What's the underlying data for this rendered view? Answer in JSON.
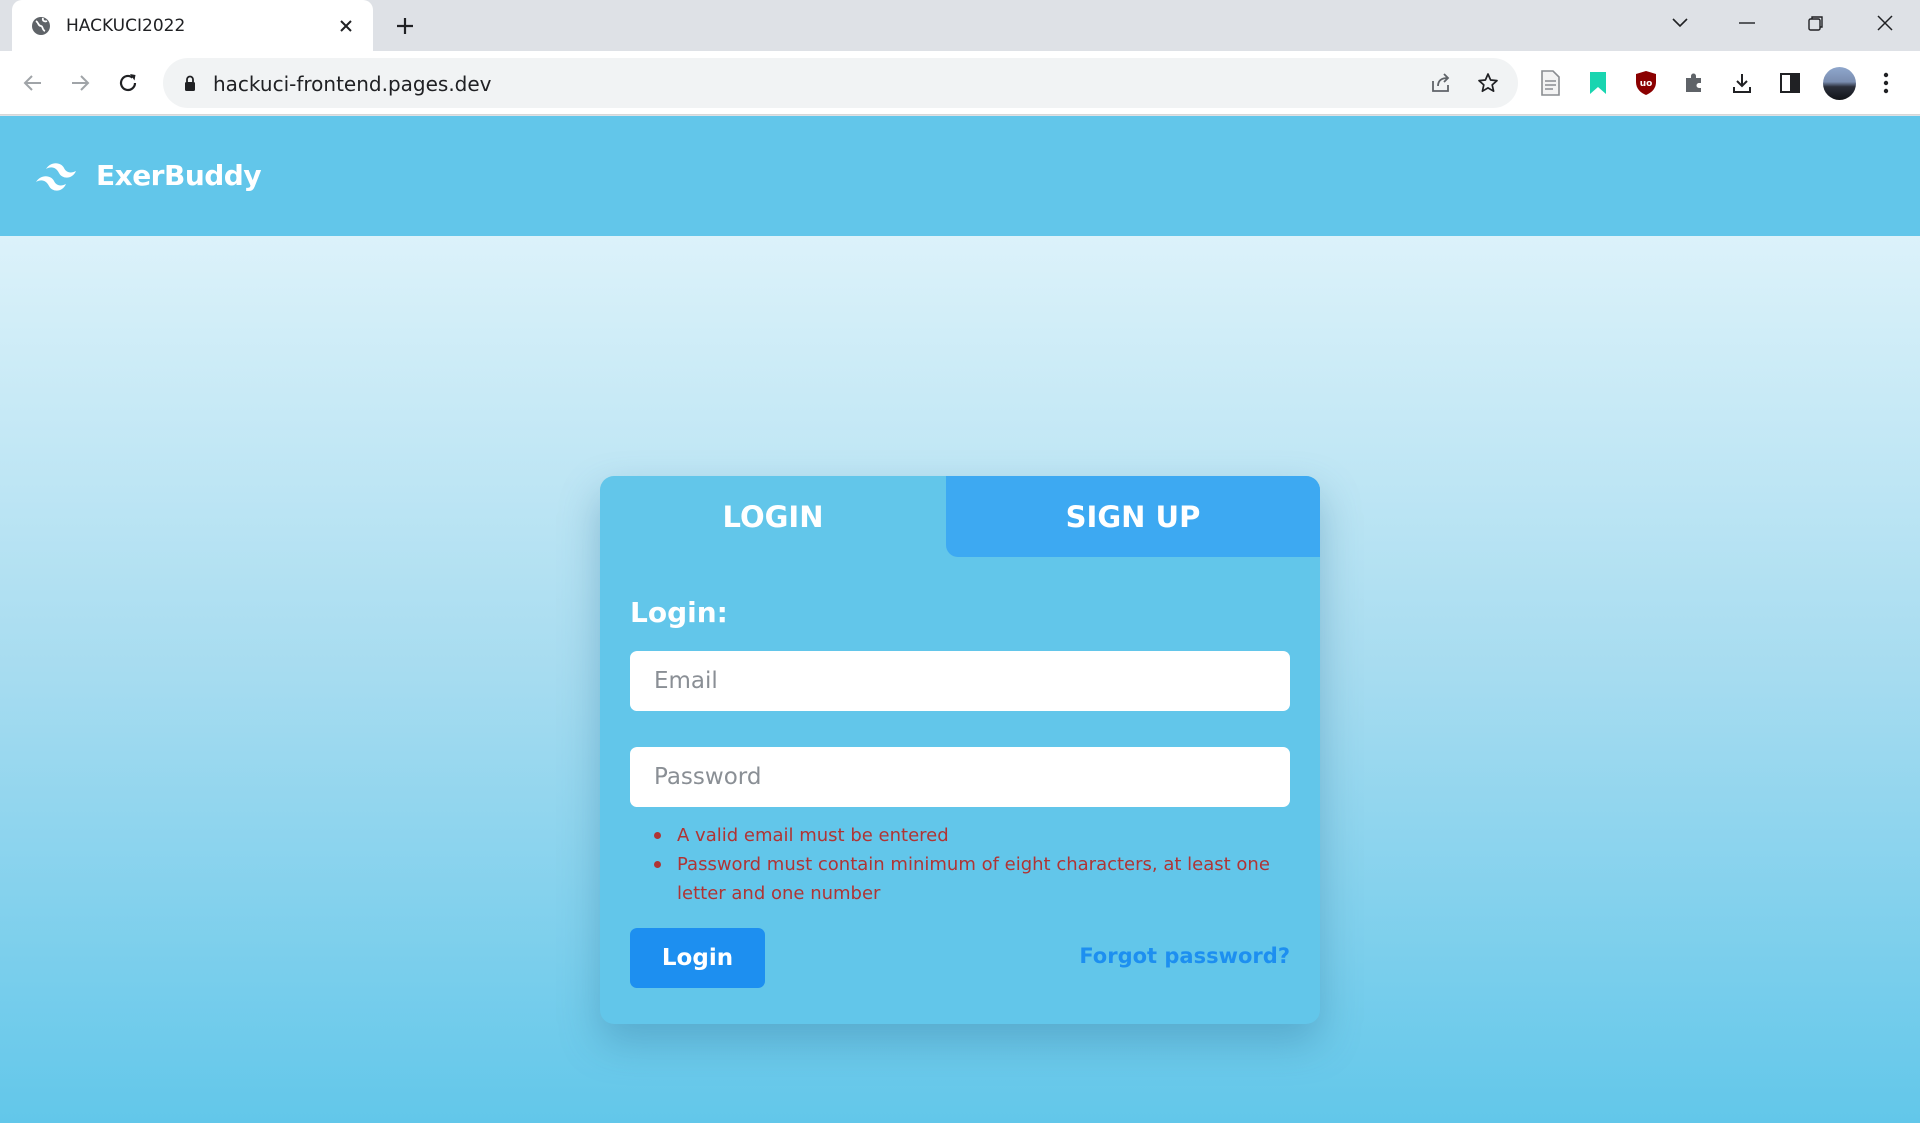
{
  "browser": {
    "tab_title": "HACKUCI2022",
    "url": "hackuci-frontend.pages.dev",
    "icons": [
      "globe-icon",
      "close-icon",
      "plus-icon",
      "chevron-down-icon",
      "minimize-icon",
      "restore-icon",
      "back-icon",
      "forward-icon",
      "reload-icon",
      "lock-icon",
      "share-icon",
      "star-icon",
      "reader-icon",
      "bookmark-ext-icon",
      "ublock-icon",
      "puzzle-icon",
      "download-icon",
      "sidepanel-icon",
      "avatar",
      "kebab-menu-icon"
    ]
  },
  "site": {
    "brand": "ExerBuddy"
  },
  "auth": {
    "tabs": {
      "login": "LOGIN",
      "signup": "SIGN UP"
    },
    "form_title": "Login:",
    "email_placeholder": "Email",
    "password_placeholder": "Password",
    "errors": [
      "A valid email must be entered",
      "Password must contain minimum of eight characters, at least one letter and one number"
    ],
    "submit_label": "Login",
    "forgot_label": "Forgot password?"
  },
  "colors": {
    "header_bg": "#62c6ea",
    "card_bg": "#62c6ea",
    "signup_tab_bg": "#3da9f2",
    "button_bg": "#1d8ff0",
    "error": "#b03434"
  }
}
